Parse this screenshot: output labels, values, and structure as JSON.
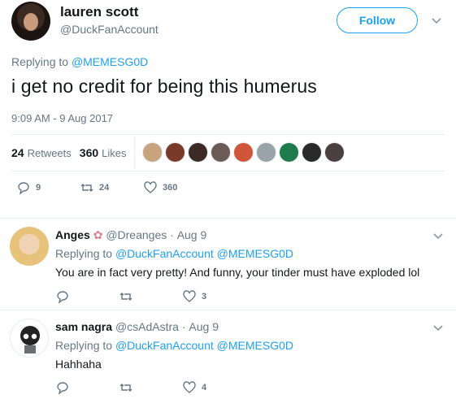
{
  "main_tweet": {
    "display_name": "lauren scott",
    "handle": "@DuckFanAccount",
    "follow_label": "Follow",
    "replying_prefix": "Replying to",
    "replying_to": "@MEMESG0D",
    "text": "i get no credit for being this humerus",
    "timestamp": "9:09 AM - 9 Aug 2017",
    "retweets_count": "24",
    "retweets_label": "Retweets",
    "likes_count": "360",
    "likes_label": "Likes",
    "liker_colors": [
      "#c9a27e",
      "#7a3a2a",
      "#3b2a25",
      "#6b5a55",
      "#d0563a",
      "#9aa3a8",
      "#1f7a4c",
      "#2a2a2a",
      "#4a4040"
    ],
    "actions": {
      "reply_count": "9",
      "retweet_count": "24",
      "like_count": "360"
    }
  },
  "replies": [
    {
      "name": "Anges",
      "handle": "@Dreanges",
      "date": "Aug 9",
      "replying_prefix": "Replying to",
      "replying_to": "@DuckFanAccount @MEMESG0D",
      "text": "You are in fact very pretty! And funny, your tinder must have exploded lol",
      "like_count": "3"
    },
    {
      "name": "sam nagra",
      "handle": "@csAdAstra",
      "date": "Aug 9",
      "replying_prefix": "Replying to",
      "replying_to": "@DuckFanAccount @MEMESG0D",
      "text": "Hahhaha",
      "like_count": "4"
    }
  ],
  "colors": {
    "accent": "#1da1f2",
    "muted": "#657786",
    "divider": "#e6ecf0"
  }
}
